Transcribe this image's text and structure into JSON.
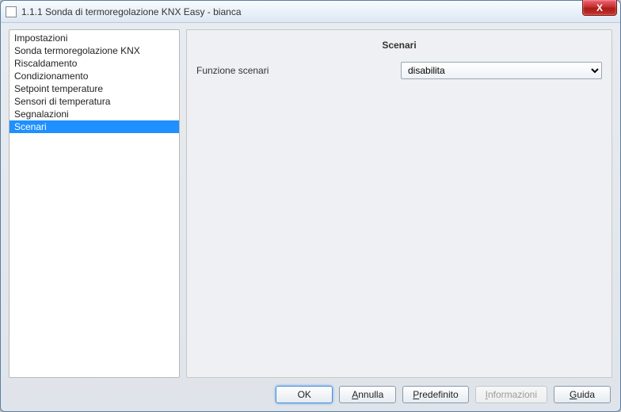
{
  "window": {
    "title": "1.1.1 Sonda di termoregolazione KNX Easy - bianca",
    "close_label": "X"
  },
  "sidebar": {
    "items": [
      {
        "label": "Impostazioni",
        "selected": false
      },
      {
        "label": "Sonda termoregolazione KNX",
        "selected": false
      },
      {
        "label": "Riscaldamento",
        "selected": false
      },
      {
        "label": "Condizionamento",
        "selected": false
      },
      {
        "label": "Setpoint temperature",
        "selected": false
      },
      {
        "label": "Sensori di temperatura",
        "selected": false
      },
      {
        "label": "Segnalazioni",
        "selected": false
      },
      {
        "label": "Scenari",
        "selected": true
      }
    ]
  },
  "content": {
    "title": "Scenari",
    "row": {
      "label": "Funzione scenari",
      "value": "disabilita"
    }
  },
  "buttons": {
    "ok": "OK",
    "cancel": "Annulla",
    "default": "Predefinito",
    "info": "Informazioni",
    "help": "Guida"
  }
}
